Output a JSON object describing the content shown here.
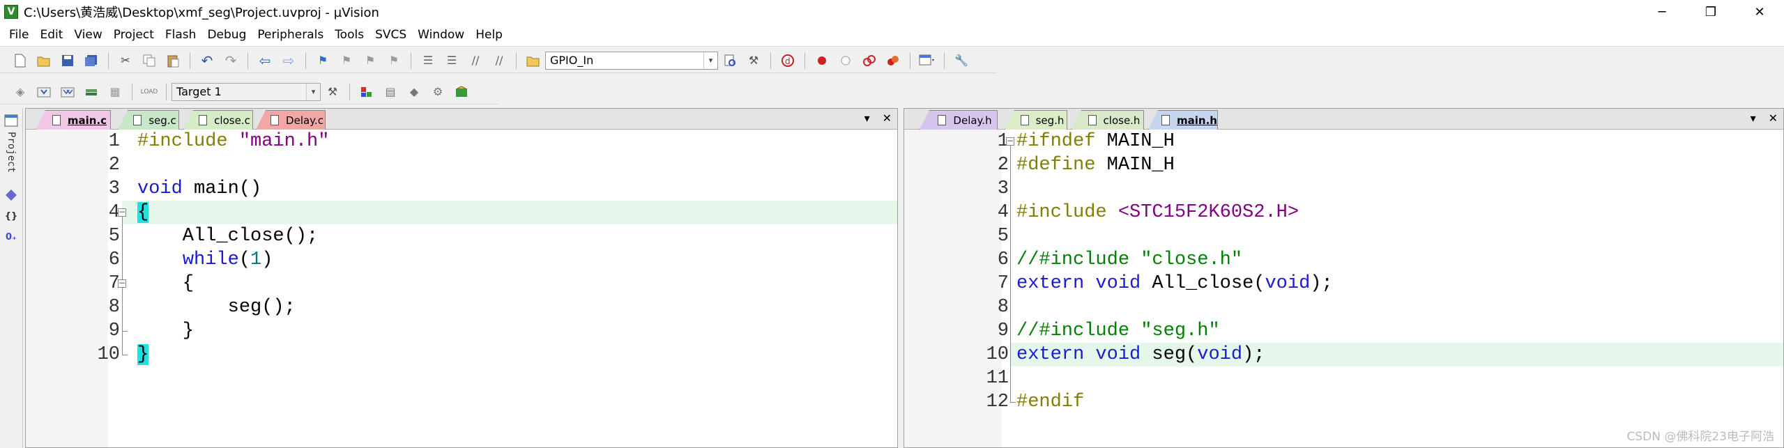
{
  "window": {
    "title": "C:\\Users\\黄浩威\\Desktop\\xmf_seg\\Project.uvproj - µVision",
    "app_icon_letter": "V",
    "controls": [
      "─",
      "❐",
      "✕"
    ]
  },
  "menu": [
    "File",
    "Edit",
    "View",
    "Project",
    "Flash",
    "Debug",
    "Peripherals",
    "Tools",
    "SVCS",
    "Window",
    "Help"
  ],
  "toolbar": {
    "find_combo": "GPIO_In",
    "target_combo": "Target 1"
  },
  "project_panel": {
    "label": "Project"
  },
  "left_editor": {
    "tabs": [
      {
        "label": "main.c",
        "color": "#f0c8e6",
        "active": true
      },
      {
        "label": "seg.c",
        "color": "#c8e6c8",
        "active": false
      },
      {
        "label": "close.c",
        "color": "#d6ecc6",
        "active": false
      },
      {
        "label": "Delay.c",
        "color": "#f2a6a6",
        "active": false
      }
    ],
    "line_numbers": [
      "1",
      "2",
      "3",
      "4",
      "5",
      "6",
      "7",
      "8",
      "9",
      "10"
    ],
    "lines": [
      [
        {
          "t": "#include ",
          "c": "pp"
        },
        {
          "t": "\"main.h\"",
          "c": "str"
        }
      ],
      [],
      [
        {
          "t": "void",
          "c": "kw"
        },
        {
          "t": " main()",
          "c": ""
        }
      ],
      [
        {
          "t": "{",
          "c": "brace-hl"
        }
      ],
      [
        {
          "t": "    All_close();",
          "c": ""
        }
      ],
      [
        {
          "t": "    ",
          "c": ""
        },
        {
          "t": "while",
          "c": "kw"
        },
        {
          "t": "(",
          "c": ""
        },
        {
          "t": "1",
          "c": "num"
        },
        {
          "t": ")",
          "c": ""
        }
      ],
      [
        {
          "t": "    {",
          "c": ""
        }
      ],
      [
        {
          "t": "        seg();",
          "c": ""
        }
      ],
      [
        {
          "t": "    }",
          "c": ""
        }
      ],
      [
        {
          "t": "}",
          "c": "brace-hl"
        }
      ]
    ]
  },
  "right_editor": {
    "tabs": [
      {
        "label": "Delay.h",
        "color": "#d6c6ee",
        "active": false
      },
      {
        "label": "seg.h",
        "color": "#dcecc6",
        "active": false
      },
      {
        "label": "close.h",
        "color": "#d8e8c8",
        "active": false
      },
      {
        "label": "main.h",
        "color": "#c6d6ee",
        "active": true
      }
    ],
    "line_numbers": [
      "1",
      "2",
      "3",
      "4",
      "5",
      "6",
      "7",
      "8",
      "9",
      "10",
      "11",
      "12"
    ],
    "lines": [
      [
        {
          "t": "#ifndef",
          "c": "pp"
        },
        {
          "t": " MAIN_H",
          "c": ""
        }
      ],
      [
        {
          "t": "#define",
          "c": "pp"
        },
        {
          "t": " MAIN_H",
          "c": ""
        }
      ],
      [],
      [
        {
          "t": "#include ",
          "c": "pp"
        },
        {
          "t": "<STC15F2K60S2.H>",
          "c": "str"
        }
      ],
      [],
      [
        {
          "t": "//#include \"close.h\"",
          "c": "cmt"
        }
      ],
      [
        {
          "t": "extern",
          "c": "kw"
        },
        {
          "t": " ",
          "c": ""
        },
        {
          "t": "void",
          "c": "kw"
        },
        {
          "t": " All_close(",
          "c": ""
        },
        {
          "t": "void",
          "c": "kw"
        },
        {
          "t": ");",
          "c": ""
        }
      ],
      [],
      [
        {
          "t": "//#include \"seg.h\"",
          "c": "cmt"
        }
      ],
      [
        {
          "t": "extern",
          "c": "kw"
        },
        {
          "t": " ",
          "c": ""
        },
        {
          "t": "void",
          "c": "kw"
        },
        {
          "t": " seg(",
          "c": ""
        },
        {
          "t": "void",
          "c": "kw"
        },
        {
          "t": ");",
          "c": ""
        }
      ],
      [],
      [
        {
          "t": "#endif",
          "c": "pp"
        }
      ]
    ]
  },
  "watermark": "CSDN @佛科院23电子阿浩"
}
